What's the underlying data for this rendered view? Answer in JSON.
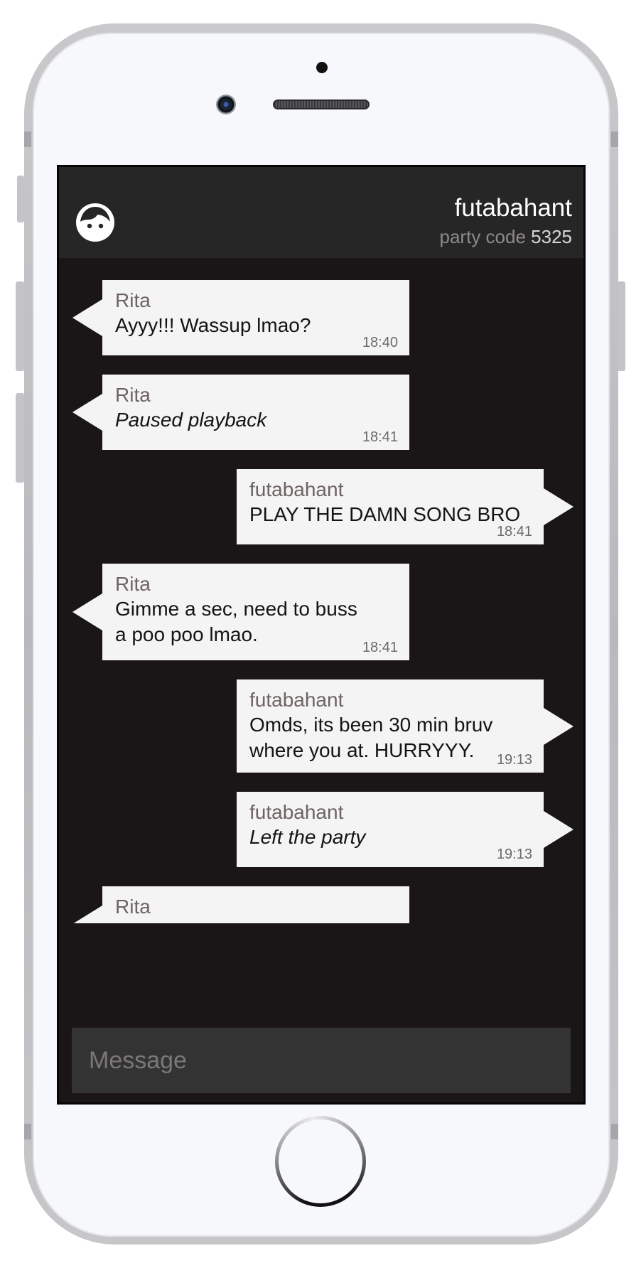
{
  "header": {
    "username": "futabahant",
    "party_code_label": "party code",
    "party_code_value": "5325",
    "avatar_icon": "face-icon"
  },
  "messages": [
    {
      "sender": "Rita",
      "text": "Ayyy!!! Wassup lmao?",
      "time": "18:40",
      "side": "left",
      "style": "normal"
    },
    {
      "sender": "Rita",
      "text": "Paused playback",
      "time": "18:41",
      "side": "left",
      "style": "italic"
    },
    {
      "sender": "futabahant",
      "text": "PLAY THE DAMN SONG BRO",
      "time": "18:41",
      "side": "right",
      "style": "normal"
    },
    {
      "sender": "Rita",
      "text": "Gimme a sec, need to buss a poo poo lmao.",
      "time": "18:41",
      "side": "left",
      "style": "normal"
    },
    {
      "sender": "futabahant",
      "text": "Omds, its been 30 min bruv where you at. HURRYYY.",
      "time": "19:13",
      "side": "right",
      "style": "normal"
    },
    {
      "sender": "futabahant",
      "text": "Left the party",
      "time": "19:13",
      "side": "right",
      "style": "italic"
    },
    {
      "sender": "Rita",
      "text": "",
      "time": "",
      "side": "left",
      "style": "normal"
    }
  ],
  "composer": {
    "placeholder": "Message",
    "value": ""
  },
  "colors": {
    "screen_bg": "#1a1617",
    "header_bg": "#262626",
    "bubble_bg": "#f4f4f4",
    "sender_text": "#6d6363",
    "composer_bg": "#333333"
  }
}
